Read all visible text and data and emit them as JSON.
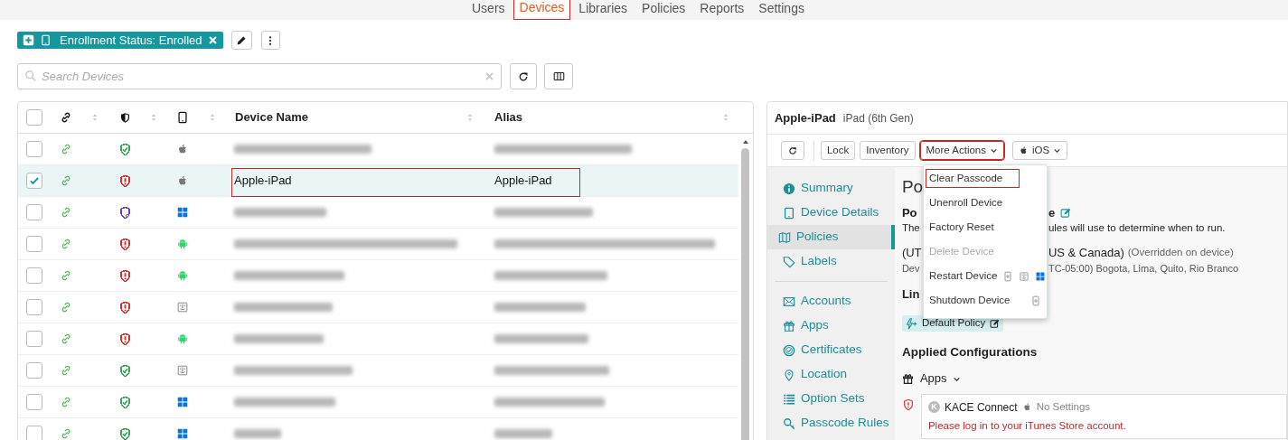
{
  "nav_tabs": [
    {
      "label": "Users",
      "selected": false
    },
    {
      "label": "Devices",
      "selected": true
    },
    {
      "label": "Libraries",
      "selected": false
    },
    {
      "label": "Policies",
      "selected": false
    },
    {
      "label": "Reports",
      "selected": false
    },
    {
      "label": "Settings",
      "selected": false
    }
  ],
  "filter_chip": {
    "label": "Enrollment Status: Enrolled"
  },
  "search": {
    "placeholder": "Search Devices"
  },
  "table": {
    "all_selected": false,
    "columns": [
      {
        "kind": "link"
      },
      {
        "kind": "compliance"
      },
      {
        "kind": "platform"
      },
      {
        "kind": "text",
        "label": "Device Name"
      },
      {
        "kind": "text",
        "label": "Alias"
      }
    ],
    "rows": [
      {
        "selected": false,
        "color": "#3aa655",
        "kind": "apple",
        "redacted": true
      },
      {
        "selected": true,
        "color": "#d32f2f",
        "kind": "apple",
        "redacted": false,
        "name": "Apple-iPad",
        "alias": "Apple-iPad",
        "highlighted": true
      },
      {
        "selected": false,
        "color": "#6a3fb5",
        "kind": "windows",
        "redacted": true
      },
      {
        "selected": false,
        "color": "#d32f2f",
        "kind": "android",
        "redacted": true
      },
      {
        "selected": false,
        "color": "#d32f2f",
        "kind": "android",
        "redacted": true
      },
      {
        "selected": false,
        "color": "#d32f2f",
        "kind": "mac",
        "redacted": true
      },
      {
        "selected": false,
        "color": "#d32f2f",
        "kind": "android",
        "redacted": true
      },
      {
        "selected": false,
        "color": "#3aa655",
        "kind": "mac",
        "redacted": true
      },
      {
        "selected": false,
        "color": "#3aa655",
        "kind": "windows",
        "redacted": true
      },
      {
        "selected": false,
        "color": "#3aa655",
        "kind": "windows",
        "redacted": true
      }
    ]
  },
  "detail": {
    "title": "Apple-iPad",
    "subtitle": "iPad (6th Gen)",
    "toolbar": [
      {
        "kind": "icon"
      },
      {
        "kind": "button",
        "label": "Lock",
        "highlighted": false
      },
      {
        "kind": "button",
        "label": "Inventory",
        "highlighted": false
      },
      {
        "kind": "dropdown",
        "label": "More Actions",
        "highlighted": true
      },
      {
        "kind": "platform",
        "label": "iOS",
        "highlighted": false
      }
    ],
    "sidebar": [
      {
        "label": "Summary",
        "selected": false
      },
      {
        "label": "Device Details",
        "selected": false
      },
      {
        "label": "Policies",
        "selected": true
      },
      {
        "label": "Labels",
        "selected": false
      },
      {
        "kind": "divider"
      },
      {
        "label": "Accounts",
        "selected": false
      },
      {
        "label": "Apps",
        "selected": false
      },
      {
        "label": "Certificates",
        "selected": false
      },
      {
        "label": "Location",
        "selected": false
      },
      {
        "label": "Option Sets",
        "selected": false
      },
      {
        "label": "Passcode Rules",
        "selected": false
      }
    ],
    "content_lines": [
      {
        "kind": "heading",
        "left": "Po"
      },
      {
        "kind": "subheading",
        "left": "Po",
        "right": "e",
        "editable": true
      },
      {
        "kind": "text",
        "left": "The",
        "right": "ules will use to determine when to run."
      },
      {
        "kind": "zone",
        "left": "(UT",
        "right": "US & Canada)",
        "note": "(Overridden on device)"
      },
      {
        "kind": "small",
        "left": "Dev",
        "right": "TC-05:00) Bogota, Lima, Quito, Rio Branco"
      },
      {
        "kind": "subheading",
        "left": "Lin"
      }
    ],
    "policy_chip": {
      "label": "Default Policy"
    },
    "applied_heading": "Applied Configurations",
    "apps_section": {
      "label": "Apps",
      "expanded": true
    },
    "app_card": {
      "avatar": "K",
      "name": "KACE Connect",
      "setting": "No Settings",
      "error": "Please log in to your iTunes Store account."
    }
  },
  "menu": [
    {
      "label": "Clear Passcode",
      "disabled": false,
      "highlighted": true
    },
    {
      "label": "Unenroll Device",
      "disabled": false,
      "highlighted": false
    },
    {
      "label": "Factory Reset",
      "disabled": false,
      "highlighted": false
    },
    {
      "label": "Delete Device",
      "disabled": true,
      "highlighted": false
    },
    {
      "label": "Restart Device",
      "disabled": false,
      "highlighted": false,
      "platform_icons": [
        {
          "kind": "ios"
        },
        {
          "kind": "mac"
        },
        {
          "kind": "windows"
        }
      ]
    },
    {
      "label": "Shutdown Device",
      "disabled": false,
      "highlighted": false,
      "platform_icons": [
        {
          "kind": "ios"
        }
      ]
    }
  ]
}
